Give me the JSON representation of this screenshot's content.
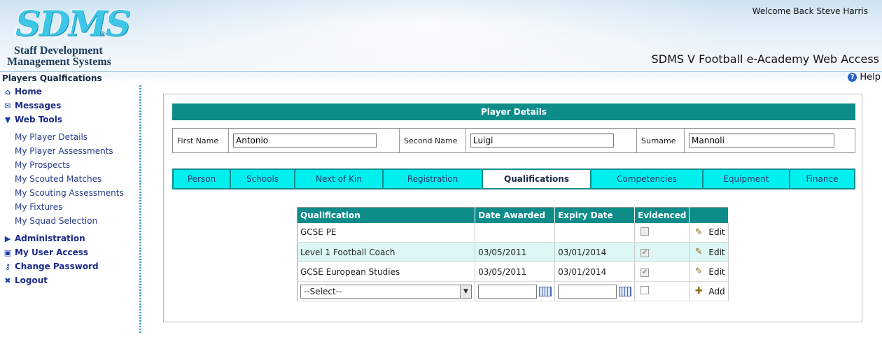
{
  "header": {
    "logo_mark": "SDMS",
    "logo_reg": "®",
    "logo_line1": "Staff Development",
    "logo_line2": "Management Systems",
    "welcome": "Welcome Back Steve Harris",
    "app_title": "SDMS V Football e-Academy Web Access"
  },
  "titlebar": {
    "page_title": "Players Qualfications",
    "help_label": "Help",
    "help_icon": "question-icon"
  },
  "sidebar": {
    "items": [
      {
        "label": "Home",
        "icon": "house-icon"
      },
      {
        "label": "Messages",
        "icon": "envelope-icon"
      },
      {
        "label": "Web Tools",
        "icon": "triangle-down-icon"
      }
    ],
    "web_tools": [
      "My Player Details",
      "My Player Assessments",
      "My Prospects",
      "My Scouted Matches",
      "My Scouting Assessments",
      "My Fixtures",
      "My Squad Selection"
    ],
    "bottom_items": [
      {
        "label": "Administration",
        "icon": "triangle-right-icon"
      },
      {
        "label": "My User Access",
        "icon": "lock-icon"
      },
      {
        "label": "Change Password",
        "icon": "key-icon"
      },
      {
        "label": "Logout",
        "icon": "x-icon"
      }
    ]
  },
  "player_details": {
    "title": "Player Details",
    "first_name_label": "First Name",
    "first_name": "Antonio",
    "second_name_label": "Second Name",
    "second_name": "Luigi",
    "surname_label": "Surname",
    "surname": "Mannoli"
  },
  "tabs": [
    "Person",
    "Schools",
    "Next of Kin",
    "Registration",
    "Qualifications",
    "Competencies",
    "Equipment",
    "Finance"
  ],
  "active_tab": "Qualifications",
  "qualifications": {
    "columns": [
      "Qualification",
      "Date Awarded",
      "Expiry Date",
      "Evidenced"
    ],
    "rows": [
      {
        "qualification": "GCSE PE",
        "date_awarded": "",
        "expiry_date": "",
        "evidenced": false,
        "action": "Edit"
      },
      {
        "qualification": "Level 1 Football Coach",
        "date_awarded": "03/05/2011",
        "expiry_date": "03/01/2014",
        "evidenced": true,
        "action": "Edit"
      },
      {
        "qualification": "GCSE European Studies",
        "date_awarded": "03/05/2011",
        "expiry_date": "03/01/2014",
        "evidenced": true,
        "action": "Edit"
      }
    ],
    "new_row": {
      "select_value": "--Select--",
      "action": "Add"
    }
  },
  "colors": {
    "teal": "#0d8c8a",
    "cyan_tab": "#00f0f0",
    "nav_text": "#1a2a88",
    "alt_row": "#ddf7f7"
  }
}
